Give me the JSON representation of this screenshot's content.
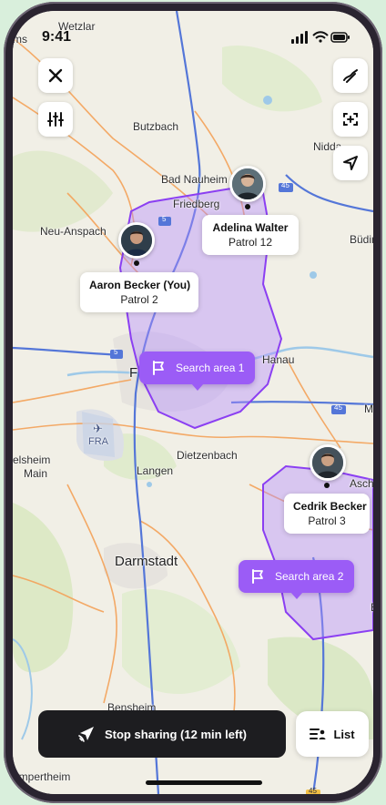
{
  "status": {
    "time": "9:41"
  },
  "map_labels": {
    "wetzlar": "Wetzlar",
    "ms": "ms",
    "butzbach": "Butzbach",
    "nidda": "Nidda",
    "bad_nauheim": "Bad Nauheim",
    "friedberg": "Friedberg",
    "neu_anspach": "Neu-Anspach",
    "buding": "Büding",
    "hanau": "Hanau",
    "f": "F",
    "m": "M",
    "fra": "FRA",
    "dietzenbach": "Dietzenbach",
    "elsheim": "elsheim",
    "main": "Main",
    "langen": "Langen",
    "ascha": "Ascha",
    "darmstadt": "Darmstadt",
    "en": "En",
    "bensheim": "Bensheim",
    "lampertheim": "ampertheim",
    "road_5a": "5",
    "road_5b": "5",
    "road_45a": "45",
    "road_45b": "45",
    "road_45c": "45"
  },
  "people": [
    {
      "name": "Adelina Walter",
      "patrol": "Patrol 12"
    },
    {
      "name": "Aaron Becker (You)",
      "patrol": "Patrol 2"
    },
    {
      "name": "Cedrik Becker",
      "patrol": "Patrol 3"
    }
  ],
  "search_areas": [
    {
      "label": "Search area 1"
    },
    {
      "label": "Search area 2"
    }
  ],
  "bottom": {
    "stop_sharing": "Stop sharing (12 min left)",
    "list": "List"
  },
  "colors": {
    "area_fill": "#b48cff",
    "area_stroke": "#8b3ff2",
    "tag": "#9b5cf6",
    "road_orange": "#f4a259",
    "highway_blue": "#4a6fd1"
  },
  "icons": [
    "close-icon",
    "filter-sliders-icon",
    "draw-route-icon",
    "add-area-icon",
    "locate-arrow-icon",
    "flag-icon",
    "share-location-icon",
    "list-icon"
  ]
}
